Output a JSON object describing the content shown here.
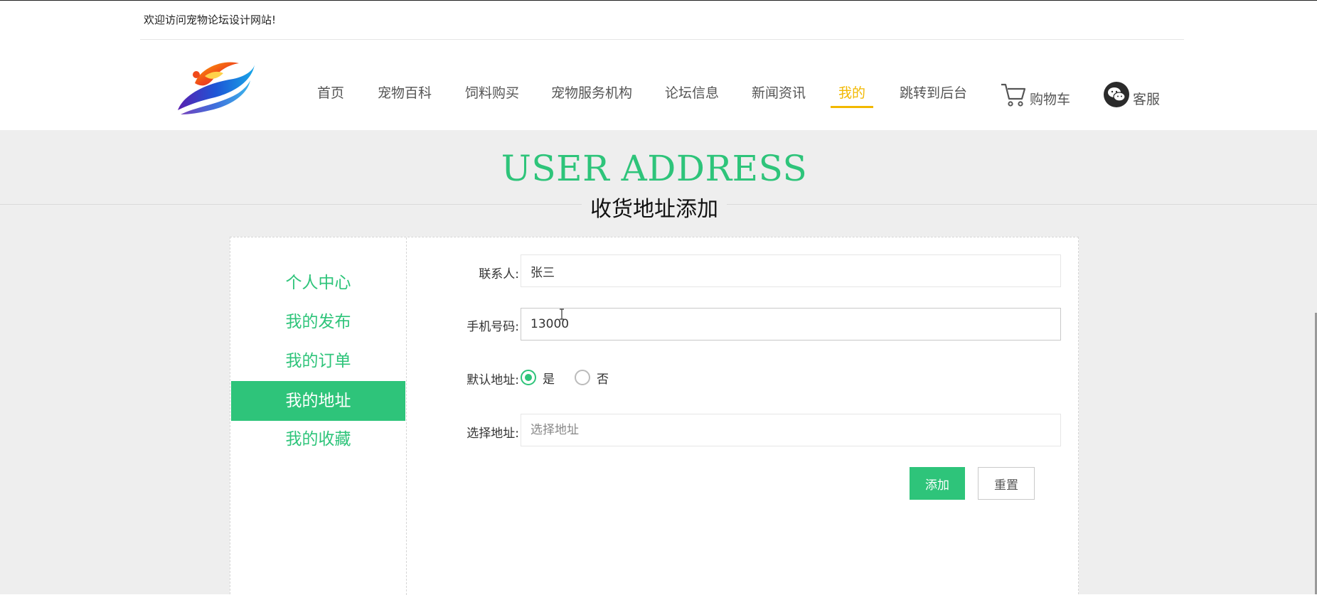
{
  "header": {
    "welcome_text": "欢迎访问宠物论坛设计网站!"
  },
  "nav": {
    "items": [
      {
        "label": "首页",
        "active": false
      },
      {
        "label": "宠物百科",
        "active": false
      },
      {
        "label": "饲料购买",
        "active": false
      },
      {
        "label": "宠物服务机构",
        "active": false
      },
      {
        "label": "论坛信息",
        "active": false
      },
      {
        "label": "新闻资讯",
        "active": false
      },
      {
        "label": "我的",
        "active": true
      },
      {
        "label": "跳转到后台",
        "active": false
      }
    ],
    "cart_label": "购物车",
    "service_label": "客服",
    "cart_icon": "cart-icon",
    "service_icon": "wechat-icon",
    "active_color": "#f2b800"
  },
  "hero": {
    "title": "USER ADDRESS",
    "subtitle": "收货地址添加"
  },
  "sidebar": {
    "items": [
      {
        "label": "个人中心",
        "active": false
      },
      {
        "label": "我的发布",
        "active": false
      },
      {
        "label": "我的订单",
        "active": false
      },
      {
        "label": "我的地址",
        "active": true
      },
      {
        "label": "我的收藏",
        "active": false
      }
    ]
  },
  "form": {
    "contact_label": "联系人:",
    "contact_value": "张三",
    "phone_label": "手机号码:",
    "phone_value": "13000",
    "default_label": "默认地址:",
    "default_options": [
      {
        "label": "是",
        "checked": true
      },
      {
        "label": "否",
        "checked": false
      }
    ],
    "address_label": "选择地址:",
    "address_placeholder": "选择地址",
    "address_value": "",
    "submit_label": "添加",
    "reset_label": "重置"
  },
  "colors": {
    "accent": "#2ec47a",
    "nav_active": "#f2b800",
    "background": "#eeeeee"
  }
}
